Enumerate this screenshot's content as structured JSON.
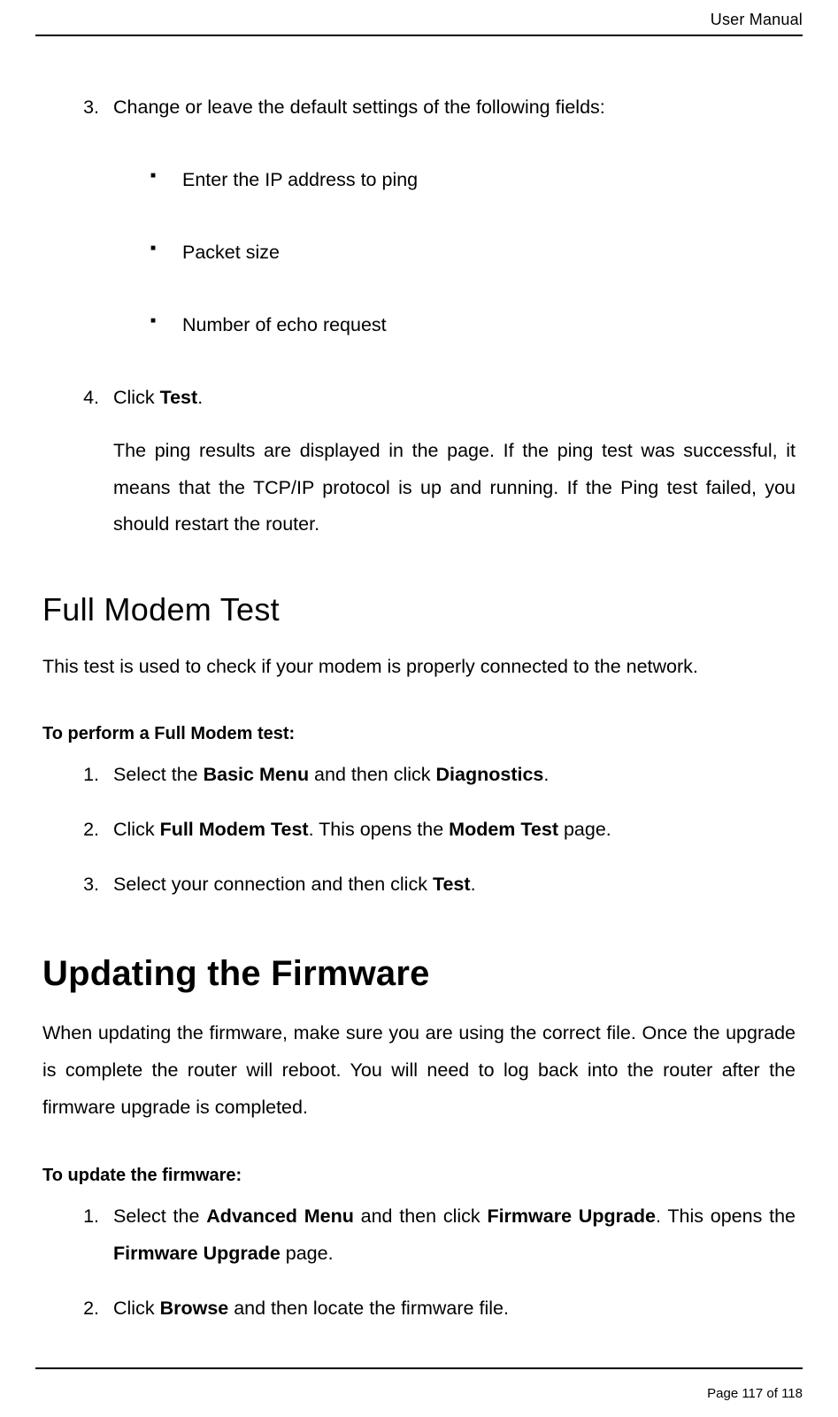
{
  "header": {
    "title": "User Manual"
  },
  "list1": {
    "item3": {
      "text": "Change or leave the default settings of the following fields:",
      "bullets": [
        "Enter the IP address to ping",
        "Packet size",
        "Number of echo request"
      ]
    },
    "item4": {
      "pre": "Click ",
      "bold": "Test",
      "post": ".",
      "para": "The ping results are displayed in the page. If the ping test was successful, it means that the TCP/IP protocol is up and running. If the Ping test failed, you should restart the router."
    }
  },
  "section1": {
    "title": "Full Modem Test",
    "lead": "This test is used to check if your modem is properly connected to the network.",
    "sub": "To perform a Full Modem test:",
    "steps": {
      "s1": {
        "a": "Select the ",
        "b1": "Basic Menu",
        "c": " and then click ",
        "b2": "Diagnostics",
        "d": "."
      },
      "s2": {
        "a": "Click ",
        "b1": "Full Modem Test",
        "c": ". This opens the ",
        "b2": "Modem Test",
        "d": " page."
      },
      "s3": {
        "a": "Select your connection and then click ",
        "b1": "Test",
        "c": "."
      }
    }
  },
  "section2": {
    "title": "Updating the Firmware",
    "lead": "When updating the firmware, make sure you are using the correct file. Once the upgrade is complete the router will reboot. You will need to log back into the router after the firmware upgrade is completed.",
    "sub": "To update the firmware:",
    "steps": {
      "s1": {
        "a": "Select the ",
        "b1": "Advanced Menu",
        "c": " and then click ",
        "b2": "Firmware Upgrade",
        "d": ". This opens the ",
        "b3": "Firmware Upgrade",
        "e": " page."
      },
      "s2": {
        "a": "Click ",
        "b1": "Browse",
        "c": " and then locate the firmware file."
      }
    }
  },
  "footer": {
    "text": "Page 117 of 118"
  }
}
